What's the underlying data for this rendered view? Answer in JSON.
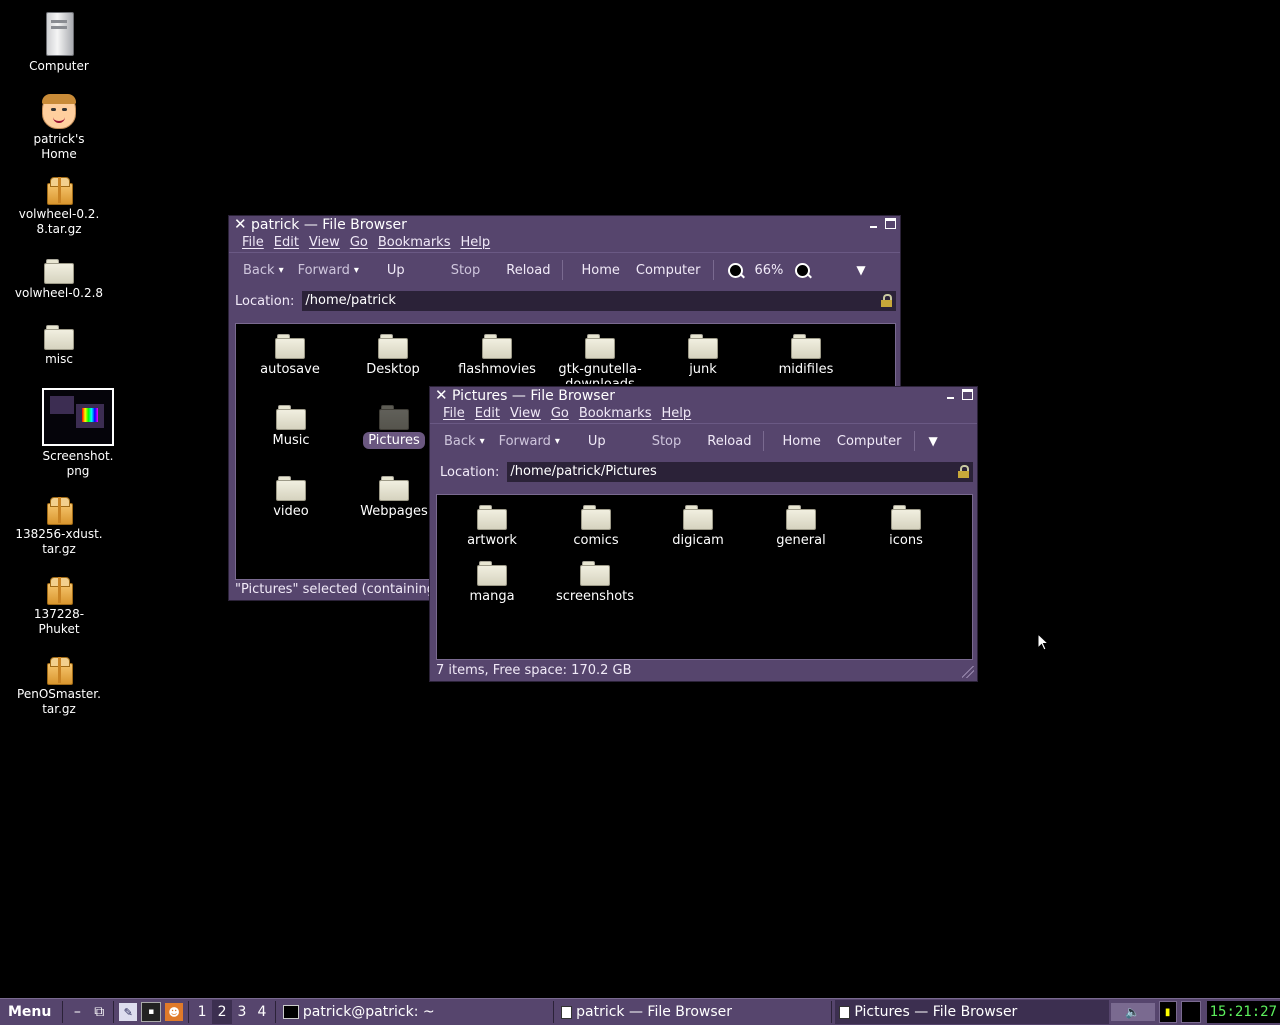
{
  "desktop": {
    "icons": [
      {
        "label1": "Computer",
        "label2": ""
      },
      {
        "label1": "patrick's",
        "label2": "Home"
      },
      {
        "label1": "volwheel-0.2.",
        "label2": "8.tar.gz"
      },
      {
        "label1": "volwheel-0.2.8",
        "label2": ""
      },
      {
        "label1": "misc",
        "label2": ""
      },
      {
        "label1": "Screenshot.",
        "label2": "png"
      },
      {
        "label1": "138256-xdust.",
        "label2": "tar.gz"
      },
      {
        "label1": "137228-",
        "label2": "Phuket"
      },
      {
        "label1": "PenOSmaster.",
        "label2": "tar.gz"
      }
    ]
  },
  "win1": {
    "title": "patrick — File Browser",
    "menus": [
      "File",
      "Edit",
      "View",
      "Go",
      "Bookmarks",
      "Help"
    ],
    "toolbar": {
      "back": "Back",
      "forward": "Forward",
      "up": "Up",
      "stop": "Stop",
      "reload": "Reload",
      "home": "Home",
      "computer": "Computer",
      "zoom": "66%"
    },
    "location_label": "Location:",
    "location": "/home/patrick",
    "items": [
      "autosave",
      "Desktop",
      "flashmovies",
      "gtk-gnutella-downloads",
      "junk",
      "midifiles",
      "Music",
      "Pictures",
      "video",
      "Webpages"
    ],
    "item_gtk_line1": "gtk-gnutella-",
    "item_gtk_line2": "downloads",
    "status": "\"Pictures\" selected (containing"
  },
  "win2": {
    "title": "Pictures — File Browser",
    "menus": [
      "File",
      "Edit",
      "View",
      "Go",
      "Bookmarks",
      "Help"
    ],
    "toolbar": {
      "back": "Back",
      "forward": "Forward",
      "up": "Up",
      "stop": "Stop",
      "reload": "Reload",
      "home": "Home",
      "computer": "Computer"
    },
    "location_label": "Location:",
    "location": "/home/patrick/Pictures",
    "items": [
      "artwork",
      "comics",
      "digicam",
      "general",
      "icons",
      "manga",
      "screenshots"
    ],
    "status": "7 items, Free space: 170.2 GB"
  },
  "taskbar": {
    "menu": "Menu",
    "workspaces": [
      "1",
      "2",
      "3",
      "4"
    ],
    "active_workspace": "2",
    "tasks": [
      "patrick@patrick: ~",
      "patrick — File Browser",
      "Pictures — File Browser"
    ],
    "clock": "15:21:27"
  },
  "colors": {
    "window_bg": "#56456d",
    "clock": "#5cf05c",
    "desktop": "#000000"
  }
}
